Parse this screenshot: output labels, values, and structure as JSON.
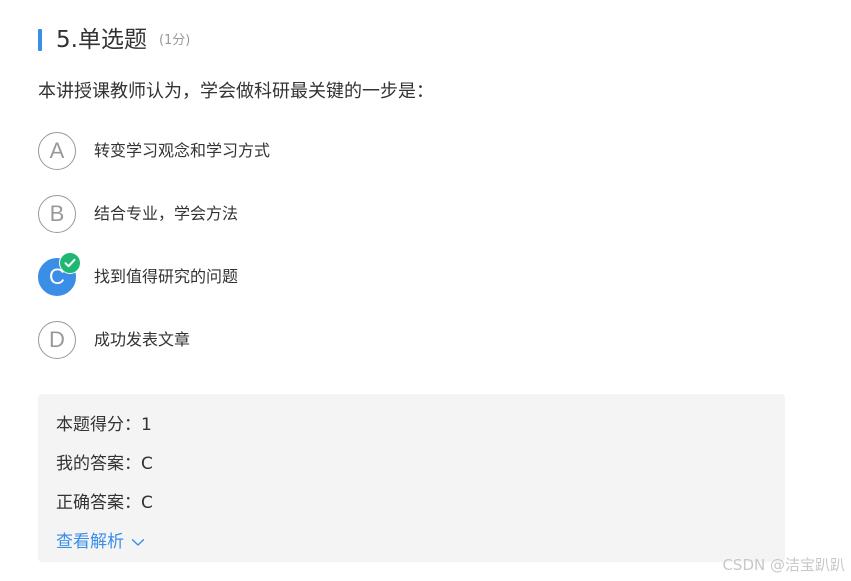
{
  "header": {
    "title": "5.单选题",
    "score": "(1分)"
  },
  "question": {
    "text": "本讲授课教师认为，学会做科研最关键的一步是："
  },
  "options": [
    {
      "letter": "A",
      "text": "转变学习观念和学习方式",
      "selected": false
    },
    {
      "letter": "B",
      "text": "结合专业，学会方法",
      "selected": false
    },
    {
      "letter": "C",
      "text": "找到值得研究的问题",
      "selected": true
    },
    {
      "letter": "D",
      "text": "成功发表文章",
      "selected": false
    }
  ],
  "result": {
    "score_line": "本题得分：1",
    "my_answer_line": "我的答案：C",
    "correct_answer_line": "正确答案：C",
    "analysis_link": "查看解析"
  },
  "watermark": "CSDN @洁宝趴趴",
  "icons": {
    "check": "check-icon",
    "chevron": "chevron-down-icon"
  },
  "colors": {
    "accent": "#3a8ee6",
    "correct": "#1eb872",
    "panel_bg": "#f4f4f4"
  }
}
